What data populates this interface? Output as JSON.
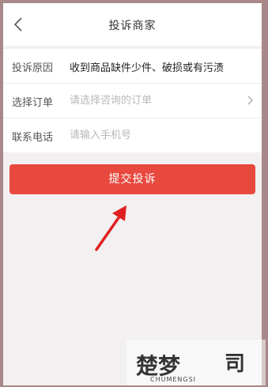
{
  "header": {
    "title": "投诉商家",
    "back_icon": "back-chevron-icon"
  },
  "form": {
    "reason": {
      "label": "投诉原因",
      "value": "收到商品缺件少件、破损或有污渍"
    },
    "order": {
      "label": "选择订单",
      "placeholder": "请选择咨询的订单",
      "chevron_icon": "chevron-right-icon"
    },
    "phone": {
      "label": "联系电话",
      "placeholder": "请输入手机号"
    }
  },
  "submit_label": "提交投诉",
  "annotation": {
    "icon": "red-arrow-icon",
    "color": "#e02020"
  },
  "watermark": {
    "logo_text": "楚梦",
    "side_char": "司",
    "subtitle": "CHUMENGSI"
  },
  "colors": {
    "accent": "#e8493f",
    "background": "#f2f0f0",
    "frame": "#a88888"
  }
}
